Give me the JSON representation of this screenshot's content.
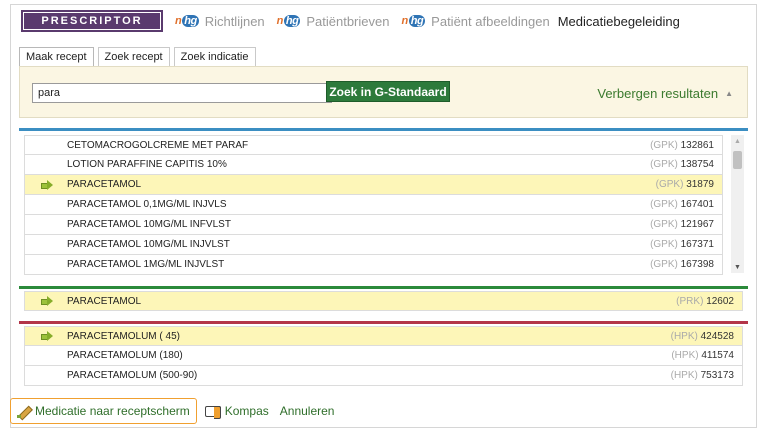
{
  "topnav": {
    "brand": "PRESCRIPTOR",
    "links": [
      {
        "label": "Richtlijnen",
        "logo": "nhg"
      },
      {
        "label": "Patiëntbrieven",
        "logo": "nhg"
      },
      {
        "label": "Patiënt afbeeldingen",
        "logo": "nhg"
      }
    ],
    "active_link": "Medicatiebegeleiding",
    "logo_text_n": "n",
    "logo_text_hg": "hg"
  },
  "tabs": [
    "Maak recept",
    "Zoek recept",
    "Zoek indicatie"
  ],
  "search": {
    "value": "para",
    "button_label": "Zoek in G-Standaard",
    "hide_label": "Verbergen resultaten",
    "hide_icon": "▲"
  },
  "gpk_results": [
    {
      "name": "CETOMACROGOLCREME MET PARAF",
      "type": "(GPK)",
      "code": "132861",
      "selected": false
    },
    {
      "name": "LOTION PARAFFINE CAPITIS 10%",
      "type": "(GPK)",
      "code": "138754",
      "selected": false
    },
    {
      "name": "PARACETAMOL",
      "type": "(GPK)",
      "code": "31879",
      "selected": true
    },
    {
      "name": "PARACETAMOL 0,1MG/ML INJVLS",
      "type": "(GPK)",
      "code": "167401",
      "selected": false
    },
    {
      "name": "PARACETAMOL 10MG/ML INFVLST",
      "type": "(GPK)",
      "code": "121967",
      "selected": false
    },
    {
      "name": "PARACETAMOL 10MG/ML INJVLST",
      "type": "(GPK)",
      "code": "167371",
      "selected": false
    },
    {
      "name": "PARACETAMOL 1MG/ML INJVLST",
      "type": "(GPK)",
      "code": "167398",
      "selected": false
    }
  ],
  "prk_results": [
    {
      "name": "PARACETAMOL",
      "type": "(PRK)",
      "code": "12602",
      "selected": true
    }
  ],
  "hpk_results": [
    {
      "name": "PARACETAMOLUM ( 45)",
      "type": "(HPK)",
      "code": "424528",
      "selected": true
    },
    {
      "name": "PARACETAMOLUM (180)",
      "type": "(HPK)",
      "code": "411574",
      "selected": false
    },
    {
      "name": "PARACETAMOLUM (500-90)",
      "type": "(HPK)",
      "code": "753173",
      "selected": false
    }
  ],
  "actions": {
    "medicatie": "Medicatie naar receptscherm",
    "kompas": "Kompas",
    "annuleren": "Annuleren"
  },
  "colors": {
    "brand": "#5a3a6e",
    "gpk_bar": "#3b8ec2",
    "prk_bar": "#2b8a3b",
    "hpk_bar": "#b33549",
    "selected_row": "#fdf6b8",
    "search_button": "#2d7a3b"
  }
}
